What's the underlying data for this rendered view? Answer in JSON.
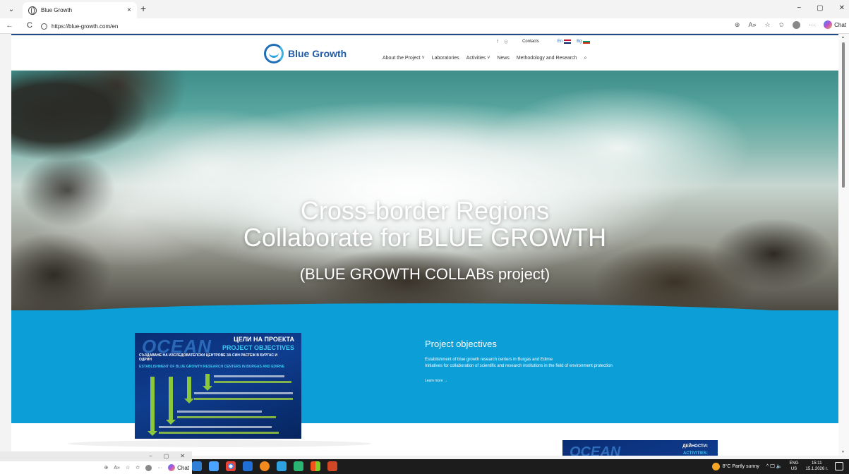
{
  "browser": {
    "tab_title": "Blue Growth",
    "tab_close": "×",
    "new_tab": "+",
    "url": "https://blue-growth.com/en",
    "back": "←",
    "reload": "C",
    "window_controls": {
      "minimize": "−",
      "maximize": "▢",
      "close": "✕"
    },
    "address_icons": {
      "zoom": "⊕",
      "read_aloud": "A»",
      "favorite": "☆",
      "favorites": "✩",
      "more": "···"
    },
    "copilot_label": "Chat"
  },
  "site": {
    "logo_text": "Blue Growth",
    "topbar": {
      "contacts": "Contacts",
      "lang_en": "En",
      "lang_bg": "Bg",
      "facebook_glyph": "f",
      "instagram_glyph": "◎"
    },
    "nav": [
      {
        "label": "About the Project ˅"
      },
      {
        "label": "Laboratories"
      },
      {
        "label": "Activities ˅"
      },
      {
        "label": "News"
      },
      {
        "label": "Methodology and Research"
      },
      {
        "label": "⌕"
      }
    ],
    "hero": {
      "title_line1": "Cross-border Regions",
      "title_line2": "Collaborate for BLUE GROWTH",
      "subtitle": "(BLUE GROWTH COLLABs project)"
    },
    "objectives": {
      "title": "Project objectives",
      "line1": "Establishment of blue growth research centers in Burgas and Edirne",
      "line2": "Initiatives for collaboration of scientific and research institutions in the field of environment protection",
      "learn_more": "Learn more →"
    },
    "poster": {
      "ocean": "OCEAN",
      "title_bg": "ЦЕЛИ НА ПРОЕКТА",
      "title_en": "PROJECT OBJECTIVES",
      "heading_bg": "СЪЗДАВАНЕ НА ИЗСЛЕДОВАТЕЛСКИ ЦЕНТРОВЕ ЗА СИН РАСТЕЖ В БУРГАС И ОДРИН",
      "heading_en": "ESTABLISHMENT OF BLUE GROWTH RESEARCH CENTERS IN BURGAS AND EDIRNE"
    },
    "poster2": {
      "ocean": "OCEAN",
      "title_bg": "ДЕЙНОСТИ:",
      "title_en": "ACTIVITIES:"
    }
  },
  "mini_window": {
    "controls": {
      "minimize": "−",
      "maximize": "▢",
      "close": "✕"
    },
    "icons": {
      "zoom": "⊕",
      "read_aloud": "A»",
      "favorite": "☆",
      "favorites": "✩",
      "more": "···"
    },
    "copilot_label": "Chat"
  },
  "taskbar": {
    "weather": "8°C  Partly sunny",
    "tray_glyphs": "^ 🖵 🔈",
    "lang_top": "ENG",
    "lang_bottom": "US",
    "time": "15:11",
    "date": "15.1.2026 г."
  },
  "colors": {
    "band": "#0c9ed7",
    "brand": "#1f5aa8",
    "taskbar": "#1c1c1c"
  }
}
